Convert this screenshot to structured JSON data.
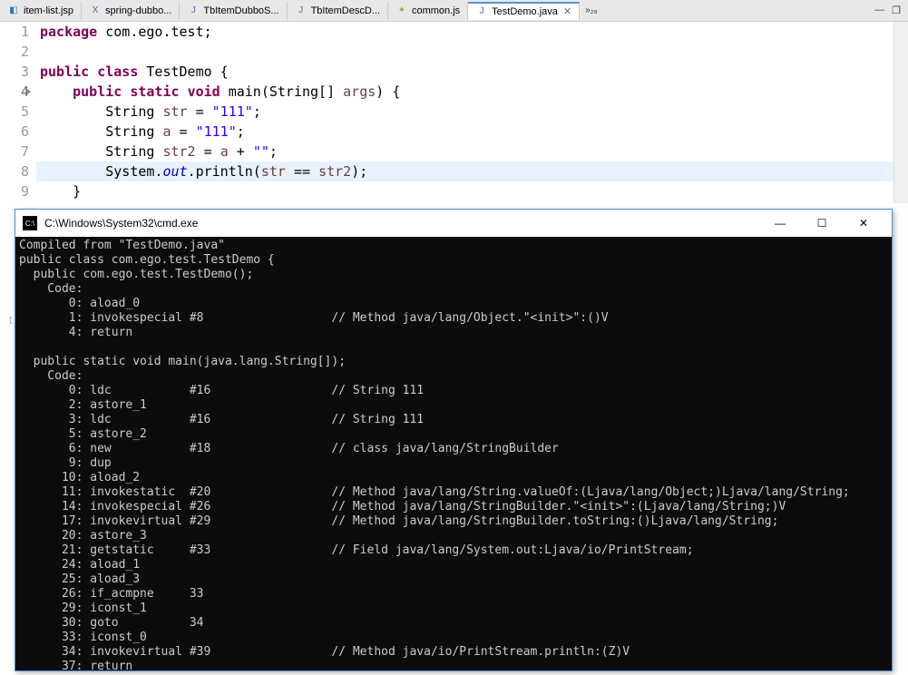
{
  "tabs": [
    {
      "label": "item-list.jsp",
      "icon": "jsp"
    },
    {
      "label": "spring-dubbo...",
      "icon": "xml"
    },
    {
      "label": "TbItemDubboS...",
      "icon": "java"
    },
    {
      "label": "TbItemDescD...",
      "icon": "java"
    },
    {
      "label": "common.js",
      "icon": "js"
    },
    {
      "label": "TestDemo.java",
      "icon": "java",
      "active": true
    }
  ],
  "overflow": "»₂₈",
  "code": {
    "lines": [
      {
        "n": "1",
        "tokens": [
          [
            "kw",
            "package"
          ],
          [
            "plain",
            " com.ego.test;"
          ]
        ]
      },
      {
        "n": "2",
        "tokens": []
      },
      {
        "n": "3",
        "tokens": [
          [
            "kw",
            "public"
          ],
          [
            "plain",
            " "
          ],
          [
            "kw",
            "class"
          ],
          [
            "plain",
            " "
          ],
          [
            "cls",
            "TestDemo"
          ],
          [
            "plain",
            " {"
          ]
        ]
      },
      {
        "n": "4",
        "cursor": true,
        "tokens": [
          [
            "plain",
            "    "
          ],
          [
            "kw",
            "public"
          ],
          [
            "plain",
            " "
          ],
          [
            "kw",
            "static"
          ],
          [
            "plain",
            " "
          ],
          [
            "kw",
            "void"
          ],
          [
            "plain",
            " "
          ],
          [
            "cls",
            "main"
          ],
          [
            "plain",
            "(String[] "
          ],
          [
            "param",
            "args"
          ],
          [
            "plain",
            ") {"
          ]
        ]
      },
      {
        "n": "5",
        "tokens": [
          [
            "plain",
            "        String "
          ],
          [
            "param",
            "str"
          ],
          [
            "plain",
            " = "
          ],
          [
            "str",
            "\"111\""
          ],
          [
            "plain",
            ";"
          ]
        ]
      },
      {
        "n": "6",
        "tokens": [
          [
            "plain",
            "        String "
          ],
          [
            "param",
            "a"
          ],
          [
            "plain",
            " = "
          ],
          [
            "str",
            "\"111\""
          ],
          [
            "plain",
            ";"
          ]
        ]
      },
      {
        "n": "7",
        "tokens": [
          [
            "plain",
            "        String "
          ],
          [
            "param",
            "str2"
          ],
          [
            "plain",
            " = "
          ],
          [
            "param",
            "a"
          ],
          [
            "plain",
            " + "
          ],
          [
            "str",
            "\"\""
          ],
          [
            "plain",
            ";"
          ]
        ]
      },
      {
        "n": "8",
        "highlight": true,
        "tokens": [
          [
            "plain",
            "        System."
          ],
          [
            "field",
            "out"
          ],
          [
            "plain",
            ".println("
          ],
          [
            "param",
            "str"
          ],
          [
            "plain",
            " == "
          ],
          [
            "param",
            "str2"
          ],
          [
            "plain",
            ");"
          ]
        ]
      },
      {
        "n": "9",
        "tokens": [
          [
            "plain",
            "    }"
          ]
        ]
      }
    ]
  },
  "console": {
    "title": "C:\\Windows\\System32\\cmd.exe",
    "lines": [
      "Compiled from \"TestDemo.java\"",
      "public class com.ego.test.TestDemo {",
      "  public com.ego.test.TestDemo();",
      "    Code:",
      "       0: aload_0",
      "       1: invokespecial #8                  // Method java/lang/Object.\"<init>\":()V",
      "       4: return",
      "",
      "  public static void main(java.lang.String[]);",
      "    Code:",
      "       0: ldc           #16                 // String 111",
      "       2: astore_1",
      "       3: ldc           #16                 // String 111",
      "       5: astore_2",
      "       6: new           #18                 // class java/lang/StringBuilder",
      "       9: dup",
      "      10: aload_2",
      "      11: invokestatic  #20                 // Method java/lang/String.valueOf:(Ljava/lang/Object;)Ljava/lang/String;",
      "      14: invokespecial #26                 // Method java/lang/StringBuilder.\"<init>\":(Ljava/lang/String;)V",
      "      17: invokevirtual #29                 // Method java/lang/StringBuilder.toString:()Ljava/lang/String;",
      "      20: astore_3",
      "      21: getstatic     #33                 // Field java/lang/System.out:Ljava/io/PrintStream;",
      "      24: aload_1",
      "      25: aload_3",
      "      26: if_acmpne     33",
      "      29: iconst_1",
      "      30: goto          34",
      "      33: iconst_0",
      "      34: invokevirtual #39                 // Method java/io/PrintStream.println:(Z)V",
      "      37: return"
    ]
  },
  "ghost": "t"
}
